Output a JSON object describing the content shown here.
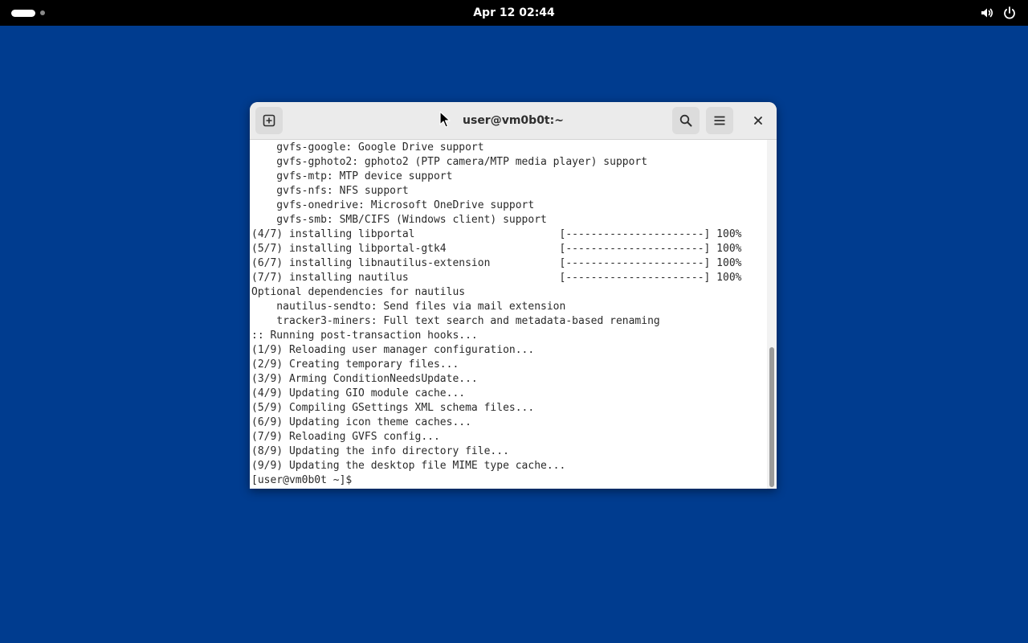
{
  "top_bar": {
    "clock": "Apr 12  02:44",
    "workspace_indicator": "activities-workspaces-icon",
    "tray_icons": [
      "volume-icon",
      "power-icon"
    ]
  },
  "window": {
    "title": "user@vm0b0t:~",
    "buttons": {
      "new_tab": "new-tab-icon",
      "search": "search-icon",
      "menu": "hamburger-menu-icon",
      "close": "close-icon"
    },
    "scroll_position_fraction": 1.0
  },
  "terminal": {
    "lines": [
      "    gvfs-google: Google Drive support",
      "    gvfs-gphoto2: gphoto2 (PTP camera/MTP media player) support",
      "    gvfs-mtp: MTP device support",
      "    gvfs-nfs: NFS support",
      "    gvfs-onedrive: Microsoft OneDrive support",
      "    gvfs-smb: SMB/CIFS (Windows client) support",
      "(4/7) installing libportal                       [----------------------] 100%",
      "(5/7) installing libportal-gtk4                  [----------------------] 100%",
      "(6/7) installing libnautilus-extension           [----------------------] 100%",
      "(7/7) installing nautilus                        [----------------------] 100%",
      "Optional dependencies for nautilus",
      "    nautilus-sendto: Send files via mail extension",
      "    tracker3-miners: Full text search and metadata-based renaming",
      ":: Running post-transaction hooks...",
      "(1/9) Reloading user manager configuration...",
      "(2/9) Creating temporary files...",
      "(3/9) Arming ConditionNeedsUpdate...",
      "(4/9) Updating GIO module cache...",
      "(5/9) Compiling GSettings XML schema files...",
      "(6/9) Updating icon theme caches...",
      "(7/9) Reloading GVFS config...",
      "(8/9) Updating the info directory file...",
      "(9/9) Updating the desktop file MIME type cache..."
    ],
    "prompt": "[user@vm0b0t ~]$ "
  },
  "colors": {
    "desktop_background": "#003c8f",
    "top_bar": "#000000",
    "headerbar": "#ebebeb",
    "terminal_text": "#2a2a2a"
  }
}
